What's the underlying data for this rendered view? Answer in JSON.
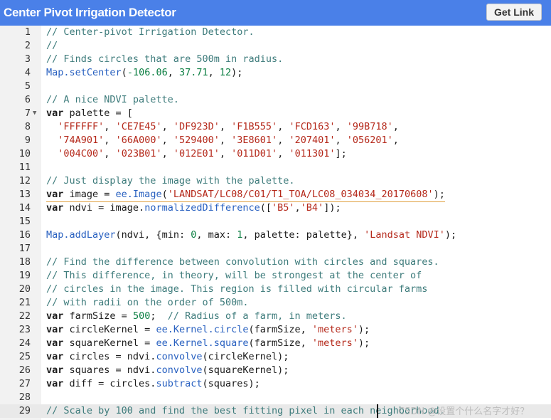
{
  "header": {
    "title": "Center Pivot Irrigation Detector",
    "get_link_label": "Get Link",
    "bg_color": "#4a80e8"
  },
  "editor": {
    "active_line": 29,
    "lines": [
      {
        "n": "1",
        "t": [
          [
            "// Center-pivot Irrigation Detector.",
            "cm"
          ]
        ]
      },
      {
        "n": "2",
        "t": [
          [
            "//",
            "cm"
          ]
        ]
      },
      {
        "n": "3",
        "t": [
          [
            "// Finds circles that are 500m in radius.",
            "cm"
          ]
        ]
      },
      {
        "n": "4",
        "t": [
          [
            "Map.setCenter",
            "fn"
          ],
          [
            "(",
            "pl"
          ],
          [
            "-106.06",
            "num"
          ],
          [
            ", ",
            "pl"
          ],
          [
            "37.71",
            "num"
          ],
          [
            ", ",
            "pl"
          ],
          [
            "12",
            "num"
          ],
          [
            ");",
            "pl"
          ]
        ]
      },
      {
        "n": "5",
        "t": []
      },
      {
        "n": "6",
        "t": [
          [
            "// A nice NDVI palette.",
            "cm"
          ]
        ]
      },
      {
        "n": "7",
        "fold": true,
        "t": [
          [
            "var",
            "kw"
          ],
          [
            " palette = [",
            "pl"
          ]
        ]
      },
      {
        "n": "8",
        "t": [
          [
            "  ",
            "pl"
          ],
          [
            "'FFFFFF'",
            "str"
          ],
          [
            ", ",
            "pl"
          ],
          [
            "'CE7E45'",
            "str"
          ],
          [
            ", ",
            "pl"
          ],
          [
            "'DF923D'",
            "str"
          ],
          [
            ", ",
            "pl"
          ],
          [
            "'F1B555'",
            "str"
          ],
          [
            ", ",
            "pl"
          ],
          [
            "'FCD163'",
            "str"
          ],
          [
            ", ",
            "pl"
          ],
          [
            "'99B718'",
            "str"
          ],
          [
            ",",
            "pl"
          ]
        ]
      },
      {
        "n": "9",
        "t": [
          [
            "  ",
            "pl"
          ],
          [
            "'74A901'",
            "str"
          ],
          [
            ", ",
            "pl"
          ],
          [
            "'66A000'",
            "str"
          ],
          [
            ", ",
            "pl"
          ],
          [
            "'529400'",
            "str"
          ],
          [
            ", ",
            "pl"
          ],
          [
            "'3E8601'",
            "str"
          ],
          [
            ", ",
            "pl"
          ],
          [
            "'207401'",
            "str"
          ],
          [
            ", ",
            "pl"
          ],
          [
            "'056201'",
            "str"
          ],
          [
            ",",
            "pl"
          ]
        ]
      },
      {
        "n": "10",
        "t": [
          [
            "  ",
            "pl"
          ],
          [
            "'004C00'",
            "str"
          ],
          [
            ", ",
            "pl"
          ],
          [
            "'023B01'",
            "str"
          ],
          [
            ", ",
            "pl"
          ],
          [
            "'012E01'",
            "str"
          ],
          [
            ", ",
            "pl"
          ],
          [
            "'011D01'",
            "str"
          ],
          [
            ", ",
            "pl"
          ],
          [
            "'011301'",
            "str"
          ],
          [
            "];",
            "pl"
          ]
        ]
      },
      {
        "n": "11",
        "t": []
      },
      {
        "n": "12",
        "t": [
          [
            "// Just display the image with the palette.",
            "cm"
          ]
        ]
      },
      {
        "n": "13",
        "t": [
          [
            "var",
            "kw"
          ],
          [
            " image = ",
            "pl"
          ],
          [
            "ee.Image",
            "fn"
          ],
          [
            "(",
            "pl"
          ],
          [
            "'LANDSAT/LC08/C01/T1_TOA/LC08_034034_20170608'",
            "str"
          ],
          [
            ");",
            "pl"
          ]
        ],
        "hl": true
      },
      {
        "n": "14",
        "t": [
          [
            "var",
            "kw"
          ],
          [
            " ndvi = image.",
            "pl"
          ],
          [
            "normalizedDifference",
            "fn"
          ],
          [
            "([",
            "pl"
          ],
          [
            "'B5'",
            "str"
          ],
          [
            ",",
            "pl"
          ],
          [
            "'B4'",
            "str"
          ],
          [
            "]);",
            "pl"
          ]
        ]
      },
      {
        "n": "15",
        "t": []
      },
      {
        "n": "16",
        "t": [
          [
            "Map.addLayer",
            "fn"
          ],
          [
            "(ndvi, {min: ",
            "pl"
          ],
          [
            "0",
            "num"
          ],
          [
            ", max: ",
            "pl"
          ],
          [
            "1",
            "num"
          ],
          [
            ", palette: palette}, ",
            "pl"
          ],
          [
            "'Landsat NDVI'",
            "str"
          ],
          [
            ");",
            "pl"
          ]
        ]
      },
      {
        "n": "17",
        "t": []
      },
      {
        "n": "18",
        "t": [
          [
            "// Find the difference between convolution with circles and squares.",
            "cm"
          ]
        ]
      },
      {
        "n": "19",
        "t": [
          [
            "// This difference, in theory, will be strongest at the center of",
            "cm"
          ]
        ]
      },
      {
        "n": "20",
        "t": [
          [
            "// circles in the image. This region is filled with circular farms",
            "cm"
          ]
        ]
      },
      {
        "n": "21",
        "t": [
          [
            "// with radii on the order of 500m.",
            "cm"
          ]
        ]
      },
      {
        "n": "22",
        "t": [
          [
            "var",
            "kw"
          ],
          [
            " farmSize = ",
            "pl"
          ],
          [
            "500",
            "num"
          ],
          [
            ";  ",
            "pl"
          ],
          [
            "// Radius of a farm, in meters.",
            "cm"
          ]
        ]
      },
      {
        "n": "23",
        "t": [
          [
            "var",
            "kw"
          ],
          [
            " circleKernel = ",
            "pl"
          ],
          [
            "ee.Kernel.circle",
            "fn"
          ],
          [
            "(farmSize, ",
            "pl"
          ],
          [
            "'meters'",
            "str"
          ],
          [
            ");",
            "pl"
          ]
        ]
      },
      {
        "n": "24",
        "t": [
          [
            "var",
            "kw"
          ],
          [
            " squareKernel = ",
            "pl"
          ],
          [
            "ee.Kernel.square",
            "fn"
          ],
          [
            "(farmSize, ",
            "pl"
          ],
          [
            "'meters'",
            "str"
          ],
          [
            ");",
            "pl"
          ]
        ]
      },
      {
        "n": "25",
        "t": [
          [
            "var",
            "kw"
          ],
          [
            " circles = ndvi.",
            "pl"
          ],
          [
            "convolve",
            "fn"
          ],
          [
            "(circleKernel);",
            "pl"
          ]
        ]
      },
      {
        "n": "26",
        "t": [
          [
            "var",
            "kw"
          ],
          [
            " squares = ndvi.",
            "pl"
          ],
          [
            "convolve",
            "fn"
          ],
          [
            "(squareKernel);",
            "pl"
          ]
        ]
      },
      {
        "n": "27",
        "t": [
          [
            "var",
            "kw"
          ],
          [
            " diff = circles.",
            "pl"
          ],
          [
            "subtract",
            "fn"
          ],
          [
            "(squares);",
            "pl"
          ]
        ]
      },
      {
        "n": "28",
        "t": []
      },
      {
        "n": "29",
        "t": [
          [
            "// Scale by 100 and find the best fitting pixel in each neighborhood.",
            "cm"
          ]
        ]
      }
    ]
  },
  "watermark": "CSDN @设置个什么名字才好？"
}
